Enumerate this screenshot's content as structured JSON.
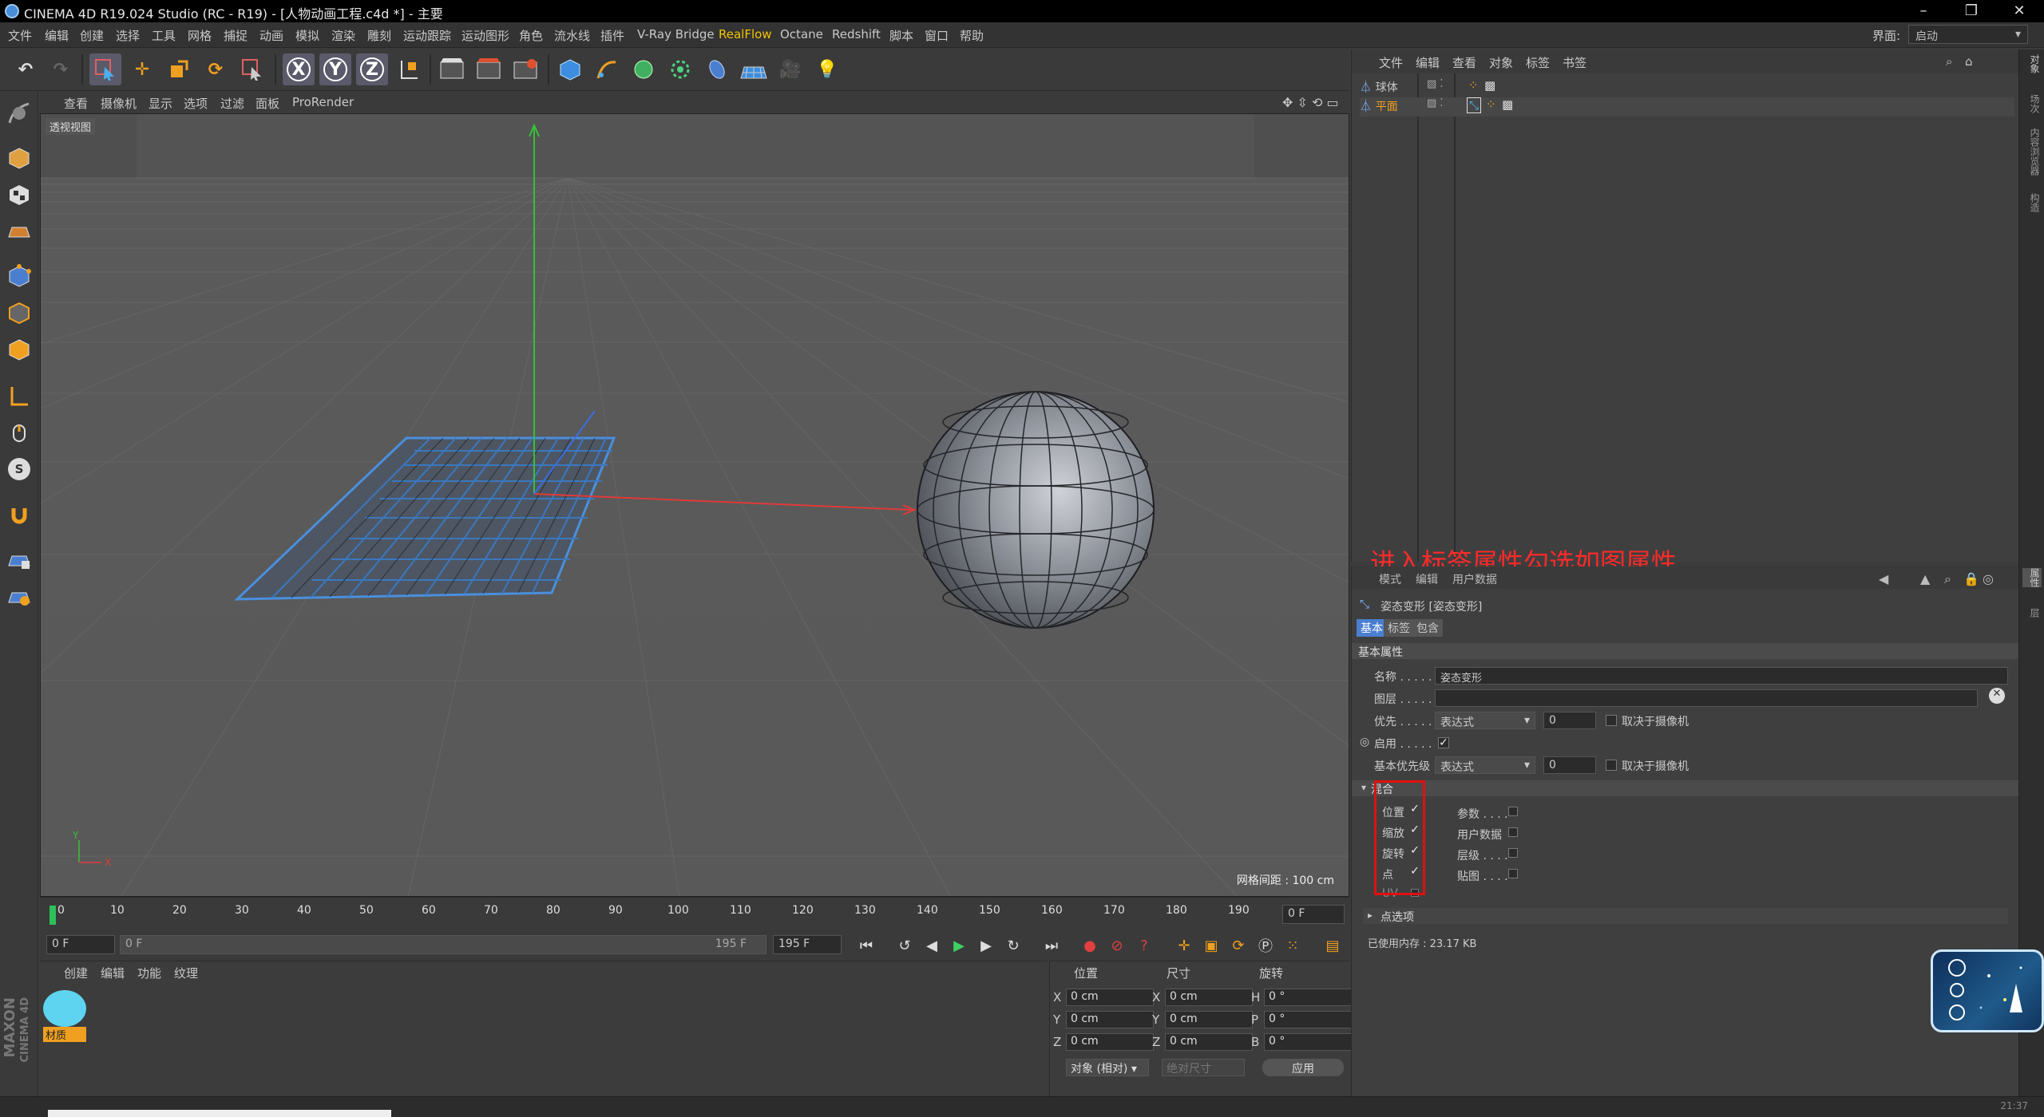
{
  "window": {
    "title": "CINEMA 4D R19.024 Studio (RC - R19) - [人物动画工程.c4d *] - 主要",
    "controls": [
      "–",
      "❐",
      "✕"
    ]
  },
  "menubar": {
    "items": [
      "文件",
      "编辑",
      "创建",
      "选择",
      "工具",
      "网格",
      "捕捉",
      "动画",
      "模拟",
      "渲染",
      "雕刻",
      "运动跟踪",
      "运动图形",
      "角色",
      "流水线",
      "插件",
      "V-Ray Bridge",
      "RealFlow",
      "Octane",
      "Redshift",
      "脚本",
      "窗口",
      "帮助"
    ],
    "highlight": "RealFlow",
    "layout_label": "界面:",
    "layout_value": "启动"
  },
  "toolbar": {
    "axis_x": "X",
    "axis_y": "Y",
    "axis_z": "Z"
  },
  "viewport": {
    "menu": [
      "查看",
      "摄像机",
      "显示",
      "选项",
      "过滤",
      "面板",
      "ProRender"
    ],
    "label": "透视视图",
    "grid_spacing": "网格间距 : 100 cm"
  },
  "timeline": {
    "ticks": [
      "0",
      "10",
      "20",
      "30",
      "40",
      "50",
      "60",
      "70",
      "80",
      "90",
      "100",
      "110",
      "120",
      "130",
      "140",
      "150",
      "160",
      "170",
      "180",
      "190"
    ],
    "current_frame_field": "0 F"
  },
  "playbar": {
    "start_field": "0 F",
    "range_start": "0 F",
    "range_end": "195 F",
    "end_field": "195 F"
  },
  "material_panel": {
    "menu": [
      "创建",
      "编辑",
      "功能",
      "纹理"
    ],
    "material_name": "材质",
    "material_color": "#5fd4f0",
    "brand_line1": "MAXON",
    "brand_line2": "CINEMA 4D"
  },
  "coordinates": {
    "headers": [
      "位置",
      "尺寸",
      "旋转"
    ],
    "rows": [
      {
        "axis": "X",
        "pos": "0 cm",
        "size_axis": "X",
        "size": "0 cm",
        "rot_axis": "H",
        "rot": "0 °"
      },
      {
        "axis": "Y",
        "pos": "0 cm",
        "size_axis": "Y",
        "size": "0 cm",
        "rot_axis": "P",
        "rot": "0 °"
      },
      {
        "axis": "Z",
        "pos": "0 cm",
        "size_axis": "Z",
        "size": "0 cm",
        "rot_axis": "B",
        "rot": "0 °"
      }
    ],
    "mode_select": "对象 (相对)",
    "size_select": "绝对尺寸",
    "apply_button": "应用"
  },
  "object_manager": {
    "menu": [
      "文件",
      "编辑",
      "查看",
      "对象",
      "标签",
      "书签"
    ],
    "objects": [
      {
        "name": "球体",
        "selected": false
      },
      {
        "name": "平面",
        "selected": true
      }
    ]
  },
  "annotation": "进入标签属性勾选如图属性",
  "attribute_manager": {
    "menu": [
      "模式",
      "编辑",
      "用户数据"
    ],
    "object_title": "姿态变形 [姿态变形]",
    "tabs": [
      "基本",
      "标签",
      "包含"
    ],
    "section_basic": "基本属性",
    "fields": {
      "name_label": "名称 . . . . .",
      "name_value": "姿态变形",
      "layer_label": "图层 . . . . .",
      "priority_label": "优先 . . . . .",
      "priority_value": "表达式",
      "priority_num": "0",
      "camera_dep_label": "取决于摄像机",
      "enable_label": "启用 . . . . .",
      "base_priority_label": "基本优先级",
      "base_priority_value": "表达式",
      "base_priority_num": "0"
    },
    "mix_section": "混合",
    "left_checks": [
      {
        "label": "位置",
        "checked": true
      },
      {
        "label": "缩放",
        "checked": true
      },
      {
        "label": "旋转",
        "checked": true
      },
      {
        "label": "点",
        "checked": true
      },
      {
        "label": "UV",
        "checked": false
      }
    ],
    "right_checks": [
      {
        "label": "参数 . . . .",
        "checked": false
      },
      {
        "label": "用户数据",
        "checked": false
      },
      {
        "label": "层级 . . . .",
        "checked": false
      },
      {
        "label": "贴图 . . . .",
        "checked": false
      }
    ],
    "point_options": "点选项",
    "memory": "已使用内存 : 23.17 KB"
  },
  "right_strip": {
    "tabs": [
      "对象",
      "场次",
      "内容浏览器",
      "构造",
      "属性",
      "层"
    ]
  },
  "statusbar": {
    "time": "21:37"
  }
}
